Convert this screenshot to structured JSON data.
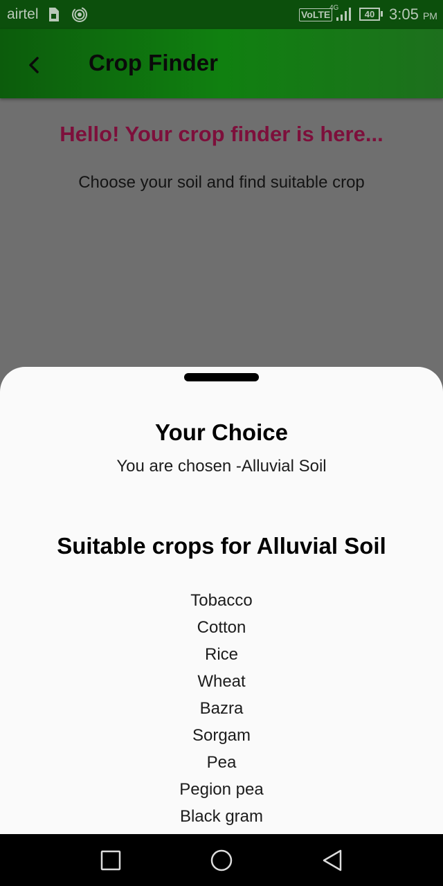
{
  "status_bar": {
    "carrier": "airtel",
    "volte": "VoLTE",
    "network": "4G",
    "battery": "40",
    "time": "3:05",
    "ampm": "PM"
  },
  "app_bar": {
    "title": "Crop Finder",
    "back_icon": "chevron-left-icon",
    "color": "#108010"
  },
  "main": {
    "greeting": "Hello! Your crop finder is here...",
    "subtitle": "Choose your soil and find suitable crop",
    "greeting_color": "#7d0f3b"
  },
  "sheet": {
    "choice_title": "Your Choice",
    "choice_text": "You are chosen -Alluvial Soil",
    "crops_title": "Suitable crops for Alluvial Soil",
    "crops": [
      "Tobacco",
      "Cotton",
      "Rice",
      "Wheat",
      "Bazra",
      "Sorgam",
      "Pea",
      "Pegion pea",
      "Black gram"
    ]
  },
  "nav_bar": {
    "recent_icon": "square-icon",
    "home_icon": "circle-icon",
    "back_icon": "triangle-back-icon"
  }
}
